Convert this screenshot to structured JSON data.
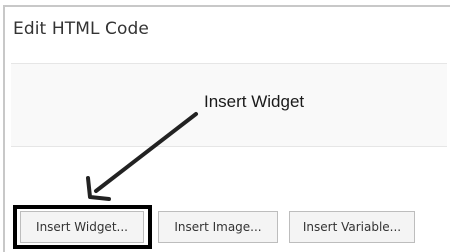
{
  "dialog": {
    "title": "Edit HTML Code"
  },
  "annotation": {
    "text": "Insert Widget",
    "arrow_icon": "arrow-down-left-icon"
  },
  "toolbar": {
    "buttons": [
      {
        "label": "Insert Widget..."
      },
      {
        "label": "Insert Image..."
      },
      {
        "label": "Insert Variable..."
      }
    ]
  },
  "colors": {
    "panel_border": "#c8c8c8",
    "band_background": "#f9f9f9",
    "button_background": "#f4f4f4",
    "highlight": "#000000"
  }
}
